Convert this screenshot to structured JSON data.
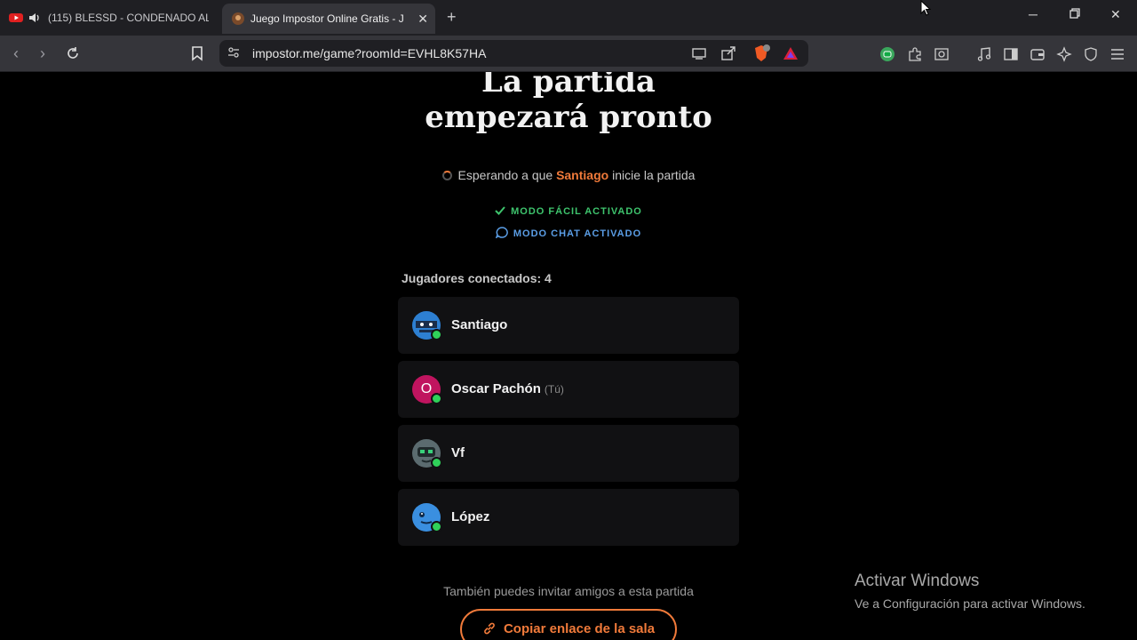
{
  "browser": {
    "tabs": [
      {
        "title": "(115) BLESSD - CONDENADO AL",
        "active": false
      },
      {
        "title": "Juego Impostor Online Gratis - J",
        "active": true
      }
    ],
    "url": "impostor.me/game?roomId=EVHL8K57HA",
    "brave_badge": "2"
  },
  "game": {
    "title_line1": "La partida",
    "title_line2": "empezará pronto",
    "waiting_prefix": "Esperando a que",
    "waiting_host": "Santiago",
    "waiting_suffix": "inicie la partida",
    "mode_easy": "MODO FÁCIL ACTIVADO",
    "mode_chat": "MODO CHAT ACTIVADO",
    "players_label": "Jugadores conectados: 4",
    "players": [
      {
        "name": "Santiago",
        "avatar": "ninja-avatar-icon",
        "you": ""
      },
      {
        "name": "Oscar Pachón",
        "avatar_letter": "O",
        "you": "(Tú)"
      },
      {
        "name": "Vf",
        "avatar": "robot-avatar-icon",
        "you": ""
      },
      {
        "name": "López",
        "avatar": "blue-face-avatar-icon",
        "you": ""
      }
    ],
    "invite_text": "También puedes invitar amigos a esta partida",
    "copy_button": "Copiar enlace de la sala"
  },
  "watermark": {
    "line1": "Activar Windows",
    "line2": "Ve a Configuración para activar Windows."
  },
  "colors": {
    "accent": "#f07a3a",
    "easy": "#3ec46d",
    "chat": "#5b9ee6",
    "online": "#2fd159"
  }
}
